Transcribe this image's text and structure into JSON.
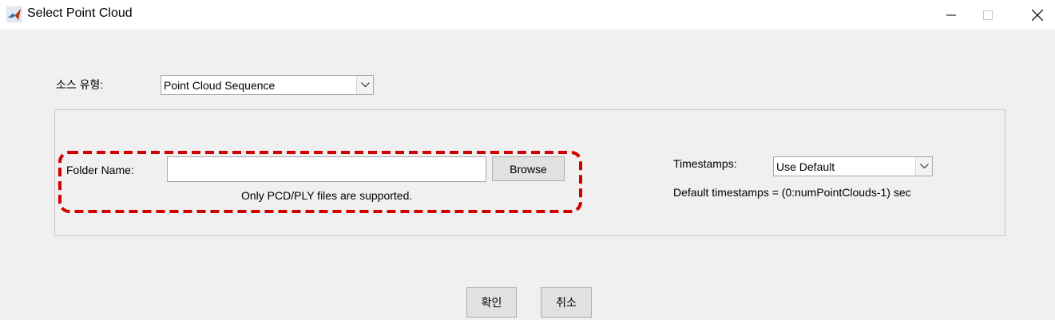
{
  "window": {
    "title": "Select Point Cloud"
  },
  "source": {
    "label": "소스 유형:",
    "selected": "Point Cloud Sequence"
  },
  "folder": {
    "label": "Folder Name:",
    "value": "",
    "browse_label": "Browse",
    "hint": "Only PCD/PLY files are supported."
  },
  "timestamps": {
    "label": "Timestamps:",
    "selected": "Use Default",
    "info": "Default timestamps = (0:numPointClouds-1) sec"
  },
  "buttons": {
    "ok": "확인",
    "cancel": "취소"
  },
  "colors": {
    "highlight": "#d10000",
    "background": "#f0f0f0",
    "button": "#e1e1e1"
  }
}
